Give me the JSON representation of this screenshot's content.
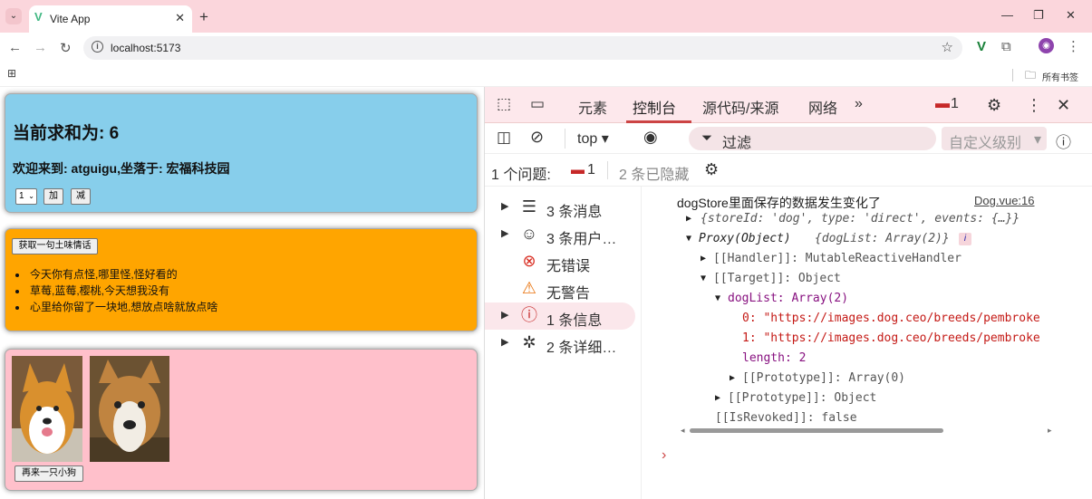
{
  "browser": {
    "tab_title": "Vite App",
    "url": "localhost:5173",
    "bookmarks_label": "所有书签"
  },
  "sum_card": {
    "heading": "当前求和为: 6",
    "welcome": "欢迎来到: atguigu,坐落于: 宏福科技园",
    "select_value": "1",
    "add_label": "加",
    "sub_label": "减"
  },
  "love_card": {
    "button_label": "获取一句土味情话",
    "items": [
      "今天你有点怪,哪里怪,怪好看的",
      "草莓,蓝莓,樱桃,今天想我没有",
      "心里给你留了一块地,想放点啥就放点啥"
    ]
  },
  "dog_card": {
    "button_label": "再来一只小狗"
  },
  "devtools": {
    "tabs": [
      "元素",
      "控制台",
      "源代码/来源",
      "网络"
    ],
    "active_tab": "控制台",
    "issue_badge": "1",
    "context": "top",
    "filter_placeholder": "过滤",
    "level_label": "自定义级别",
    "issues_label": "1 个问题:",
    "issues_count": "1",
    "hidden_label": "2 条已隐藏",
    "sidebar": [
      {
        "label": "3 条消息",
        "icon": "list-icon"
      },
      {
        "label": "3 条用户…",
        "icon": "user-icon"
      },
      {
        "label": "无错误",
        "icon": "error-icon"
      },
      {
        "label": "无警告",
        "icon": "warning-icon"
      },
      {
        "label": "1 条信息",
        "icon": "info-icon"
      },
      {
        "label": "2 条详细…",
        "icon": "bug-icon"
      }
    ],
    "console": {
      "message": "dogStore里面保存的数据发生变化了",
      "source_link": "Dog.vue:16",
      "l1": "{storeId: 'dog', type: 'direct', events: {…}}",
      "l2a": "Proxy(Object)",
      "l2b": "{dogList: Array(2)}",
      "l3": "[[Handler]]: MutableReactiveHandler",
      "l4": "[[Target]]: Object",
      "l5": "dogList: Array(2)",
      "l6": "0: \"https://images.dog.ceo/breeds/pembroke",
      "l7": "1: \"https://images.dog.ceo/breeds/pembroke",
      "l8": "length: 2",
      "l9": "[[Prototype]]: Array(0)",
      "l10": "[[Prototype]]: Object",
      "l11": "[[IsRevoked]]: false"
    }
  }
}
